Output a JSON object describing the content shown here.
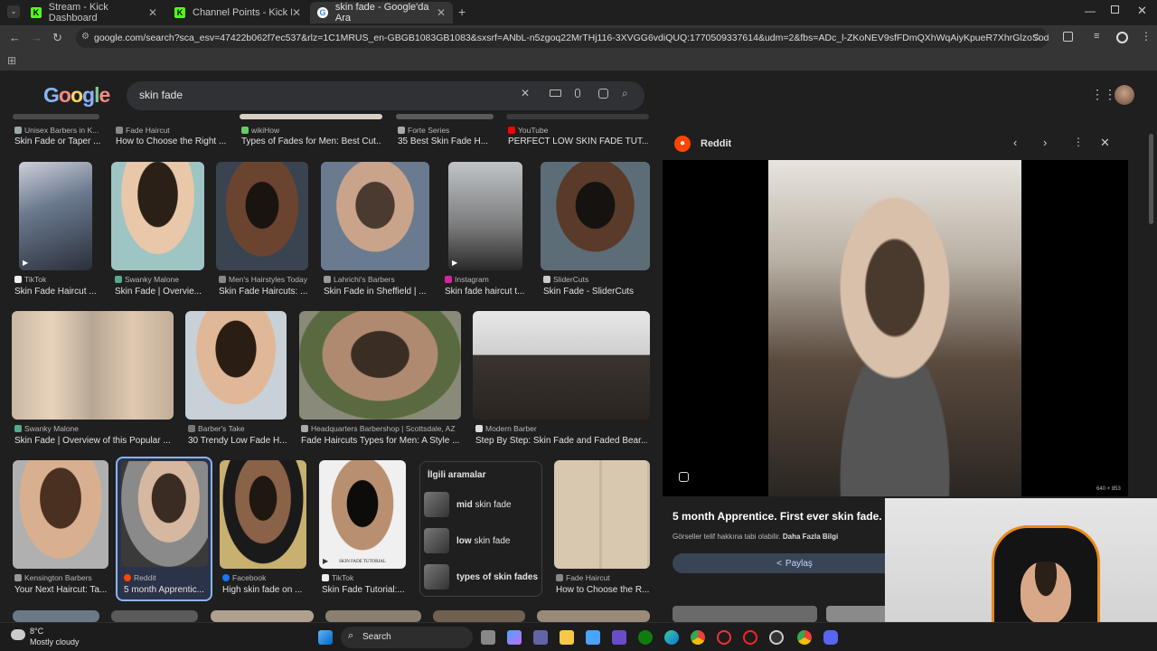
{
  "tabs": [
    {
      "title": "Stream - Kick Dashboard",
      "icon": "K"
    },
    {
      "title": "Channel Points - Kick Dashboard",
      "icon": "K"
    },
    {
      "title": "skin fade - Google'da Ara",
      "icon": "G"
    }
  ],
  "url": "google.com/search?sca_esv=47422b062f7ec537&rlz=1C1MRUS_en-GBGB1083GB1083&sxsrf=ANbL-n5zgoq22MrTHj116-3XVGG6vdiQUQ:1770509337614&udm=2&fbs=ADc_l-ZKoNEV9sfFDmQXhWqAiyKpueR7XhrGlzoSodnXPJTO0-wZXRnZmvau3m...",
  "search": {
    "query": "skin fade"
  },
  "brand": {
    "logo": "Google",
    "colors": [
      "#4285f4",
      "#ea4335",
      "#fbbc05",
      "#4285f4",
      "#34a853",
      "#ea4335"
    ]
  },
  "top_row": [
    {
      "source": "Unisex Barbers in K...",
      "title": "Skin Fade or Taper ..."
    },
    {
      "source": "Fade Haircut",
      "title": "How to Choose the Right ..."
    },
    {
      "source": "wikiHow",
      "title": "Types of Fades for Men: Best Cut..."
    },
    {
      "source": "Forte Series",
      "title": "35 Best Skin Fade H..."
    },
    {
      "source": "YouTube",
      "title": "PERFECT LOW SKIN FADE TUT..."
    }
  ],
  "row1": [
    {
      "source": "TikTok",
      "title": "Skin Fade Haircut ..."
    },
    {
      "source": "Swanky Malone",
      "title": "Skin Fade | Overvie..."
    },
    {
      "source": "Men's Hairstyles Today",
      "title": "Skin Fade Haircuts: ..."
    },
    {
      "source": "Lahrichi's Barbers",
      "title": "Skin Fade in Sheffield | ..."
    },
    {
      "source": "Instagram",
      "title": "Skin fade haircut t..."
    },
    {
      "source": "SliderCuts",
      "title": "Skin Fade - SliderCuts"
    }
  ],
  "row2": [
    {
      "source": "Swanky Malone",
      "title": "Skin Fade | Overview of this Popular ..."
    },
    {
      "source": "Barber's Take",
      "title": "30 Trendy Low Fade H..."
    },
    {
      "source": "Headquarters Barbershop | Scottsdale, AZ",
      "title": "Fade Haircuts Types for Men: A Style ..."
    },
    {
      "source": "Modern Barber",
      "title": "Step By Step: Skin Fade and Faded Bear..."
    }
  ],
  "row3": [
    {
      "source": "Kensington Barbers",
      "title": "Your Next Haircut: Ta..."
    },
    {
      "source": "Reddit",
      "title": "5 month Apprentic..."
    },
    {
      "source": "Facebook",
      "title": "High skin fade on ..."
    },
    {
      "source": "TikTok",
      "title": "Skin Fade Tutorial:..."
    },
    {
      "source": "Fade Haircut",
      "title": "How to Choose the R..."
    }
  ],
  "thumb_caption": "SKIN FADE TUTORIAL",
  "related": {
    "heading": "İlgili aramalar",
    "items": [
      {
        "bold": "mid",
        "rest": " skin fade"
      },
      {
        "bold": "low",
        "rest": " skin fade"
      },
      {
        "bold": "types of skin fades",
        "rest": ""
      }
    ]
  },
  "panel": {
    "source": "Reddit",
    "title": "5 month Apprentice. First ever skin fade. The",
    "dims": "640 × 853",
    "copyright": "Görseller telif hakkına tabi olabilir.",
    "learn_more": "Daha Fazla Bilgi",
    "share": "Paylaş"
  },
  "weather": {
    "temp": "8°C",
    "desc": "Mostly cloudy"
  },
  "taskbar": {
    "search": "Search"
  }
}
